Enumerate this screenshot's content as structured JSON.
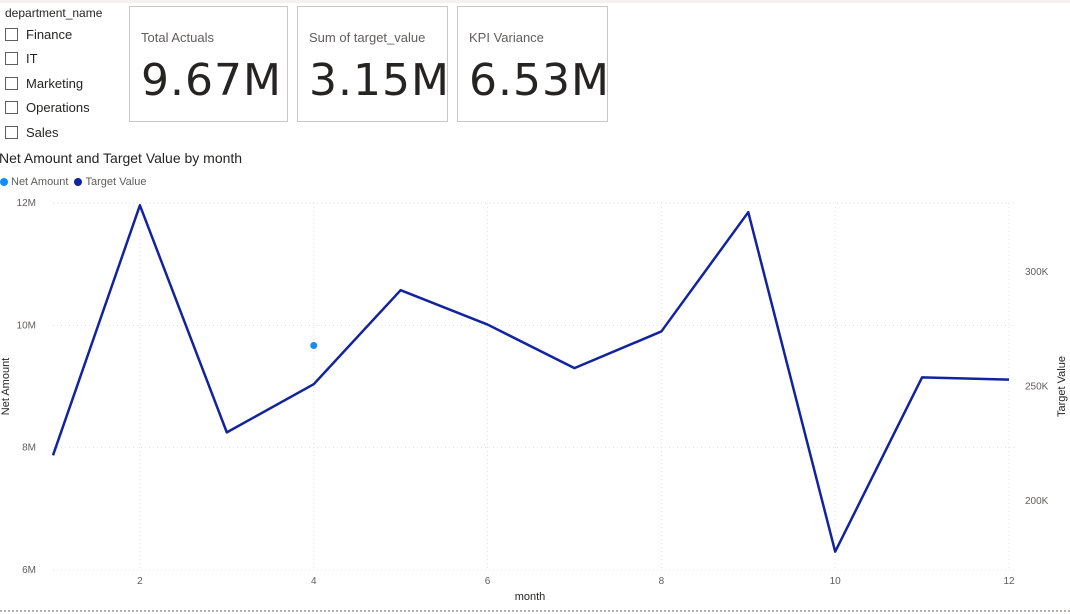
{
  "slicer": {
    "title": "department_name",
    "items": [
      "Finance",
      "IT",
      "Marketing",
      "Operations",
      "Sales"
    ]
  },
  "cards": [
    {
      "label": "Total Actuals",
      "value": "9.67M"
    },
    {
      "label": "Sum of target_value",
      "value": "3.15M"
    },
    {
      "label": "KPI Variance",
      "value": "6.53M"
    }
  ],
  "chart_data": {
    "type": "line",
    "title": "Net Amount and Target Value by month",
    "xlabel": "month",
    "ylabel_left": "Net Amount",
    "ylabel_right": "Target Value",
    "x": [
      1,
      2,
      3,
      4,
      5,
      6,
      7,
      8,
      9,
      10,
      11,
      12
    ],
    "xlim": [
      1,
      12
    ],
    "xticks": [
      2,
      4,
      6,
      8,
      10,
      12
    ],
    "y_left_lim": [
      6000000,
      12000000
    ],
    "y_left_ticks": [
      {
        "value": 6000000,
        "label": "6M"
      },
      {
        "value": 8000000,
        "label": "8M"
      },
      {
        "value": 10000000,
        "label": "10M"
      },
      {
        "value": 12000000,
        "label": "12M"
      }
    ],
    "y_right_lim": [
      170000,
      330000
    ],
    "y_right_ticks": [
      {
        "value": 200000,
        "label": "200K"
      },
      {
        "value": 250000,
        "label": "250K"
      },
      {
        "value": 300000,
        "label": "300K"
      }
    ],
    "grid": true,
    "legend_position": "top-left",
    "series": [
      {
        "name": "Net Amount",
        "axis": "left",
        "color": "#118dff",
        "render": "points",
        "points": [
          {
            "x": 4,
            "y": 9670000
          }
        ]
      },
      {
        "name": "Target Value",
        "axis": "right",
        "color": "#12239e",
        "render": "line",
        "values": [
          220000,
          329000,
          230000,
          251000,
          292000,
          277000,
          258000,
          274000,
          326000,
          178000,
          254000,
          253000
        ]
      }
    ]
  }
}
